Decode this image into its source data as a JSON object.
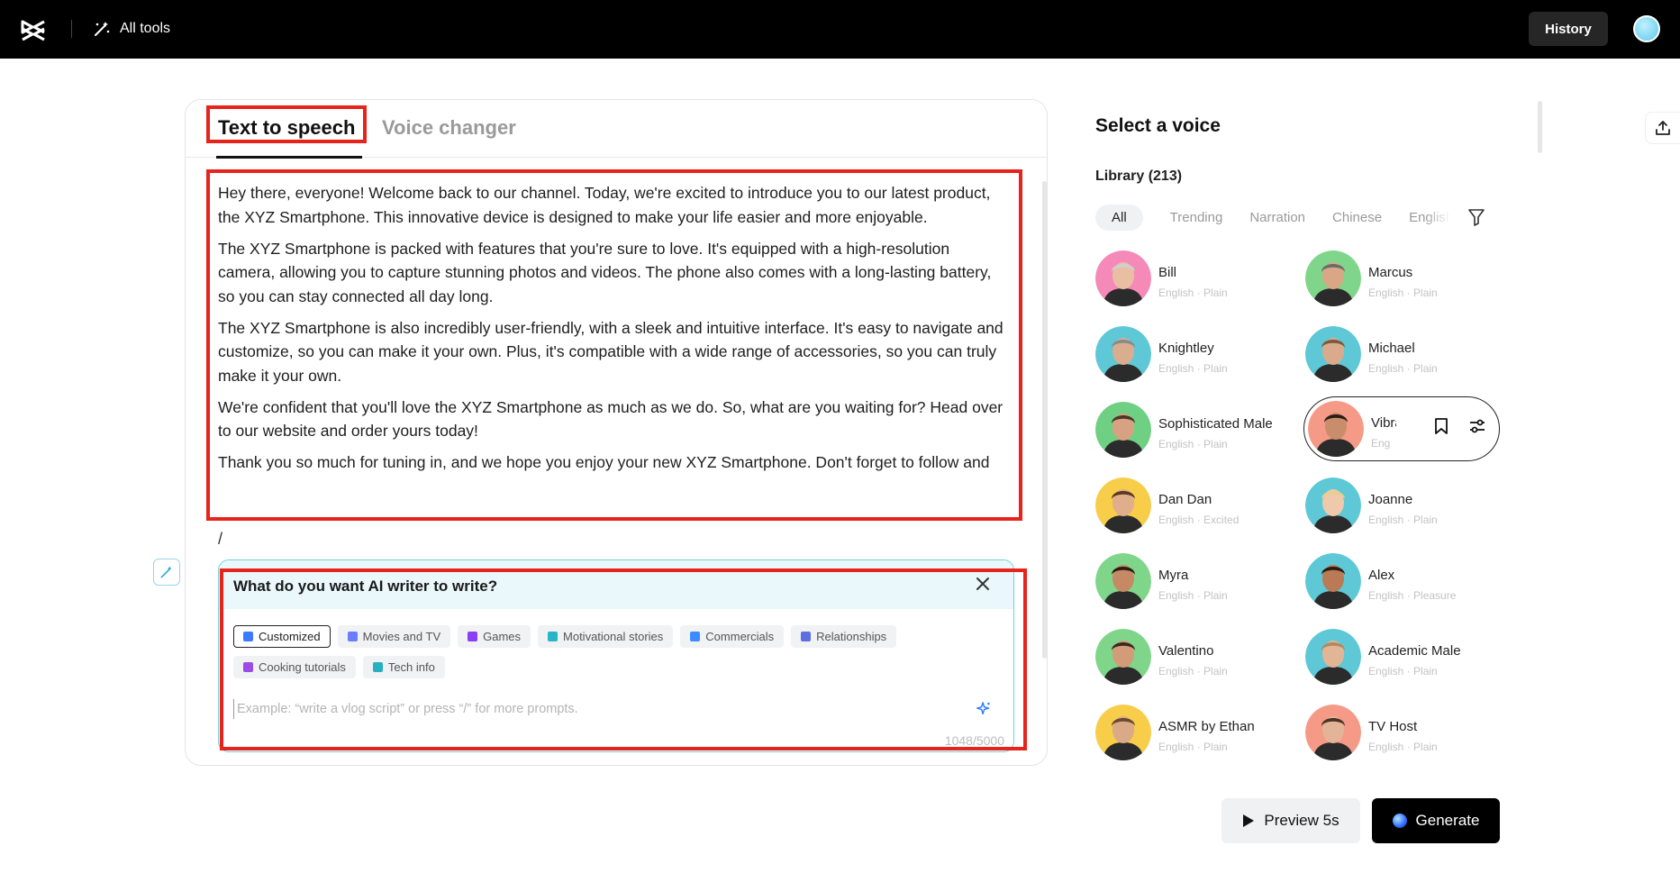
{
  "topbar": {
    "all_tools_label": "All tools",
    "history_label": "History"
  },
  "tabs": {
    "active": "Text to speech",
    "inactive": "Voice changer"
  },
  "script_paragraphs": [
    "Hey there, everyone! Welcome back to our channel. Today, we're excited to introduce you to our latest product, the XYZ Smartphone. This innovative device is designed to make your life easier and more enjoyable.",
    "The XYZ Smartphone is packed with features that you're sure to love. It's equipped with a high-resolution camera, allowing you to capture stunning photos and videos. The phone also comes with a long-lasting battery, so you can stay connected all day long.",
    "The XYZ Smartphone is also incredibly user-friendly, with a sleek and intuitive interface. It's easy to navigate and customize, so you can make it your own. Plus, it's compatible with a wide range of accessories, so you can truly make it your own.",
    "We're confident that you'll love the XYZ Smartphone as much as we do. So, what are you waiting for? Head over to our website and order yours today!",
    "Thank you so much for tuning in, and we hope you enjoy your new XYZ Smartphone. Don't forget to follow and subscribe for more exciting product announcements. Until next time, stay awesome!"
  ],
  "slash_text": "/",
  "ai_writer": {
    "title": "What do you want AI writer to write?",
    "chips": [
      {
        "label": "Customized",
        "color": "#3b7cff"
      },
      {
        "label": "Movies and TV",
        "color": "#6a7dff"
      },
      {
        "label": "Games",
        "color": "#8a3ff0"
      },
      {
        "label": "Motivational stories",
        "color": "#28b5c9"
      },
      {
        "label": "Commercials",
        "color": "#3c8cff"
      },
      {
        "label": "Relationships",
        "color": "#5c6fe0"
      },
      {
        "label": "Cooking tutorials",
        "color": "#9b4ce6"
      },
      {
        "label": "Tech info",
        "color": "#27b0c2"
      }
    ],
    "placeholder": "Example: “write a vlog script” or press “/” for more prompts.",
    "counter": "1048/5000"
  },
  "voice_panel": {
    "title": "Select a voice",
    "library": "Library (213)",
    "filters": [
      "All",
      "Trending",
      "Narration",
      "Chinese",
      "English"
    ],
    "voices": [
      {
        "name": "Bill",
        "desc": "English · Plain",
        "bg": "#f58ab8",
        "skin": "#e9bfa3",
        "hair": "#cfcfcf"
      },
      {
        "name": "Marcus",
        "desc": "English · Plain",
        "bg": "#7fd68a",
        "skin": "#d9a786",
        "hair": "#6b6b6b"
      },
      {
        "name": "Knightley",
        "desc": "English · Plain",
        "bg": "#5ec8d6",
        "skin": "#d8ad90",
        "hair": "#8a8a8a"
      },
      {
        "name": "Michael",
        "desc": "English · Plain",
        "bg": "#5ec8d6",
        "skin": "#d9ab8c",
        "hair": "#7a5a40"
      },
      {
        "name": "Sophisticated Male",
        "desc": "English · Plain",
        "bg": "#6fd083",
        "skin": "#d6a283",
        "hair": "#4a3526"
      },
      {
        "name": "Vibrant",
        "desc": "English · Plain",
        "bg": "#f59a86",
        "skin": "#c98d6c",
        "hair": "#2a1d16"
      },
      {
        "name": "Dan Dan",
        "desc": "English · Excited",
        "bg": "#f7cd4a",
        "skin": "#e0ae8a",
        "hair": "#5a3a22"
      },
      {
        "name": "Joanne",
        "desc": "English · Plain",
        "bg": "#5ec8d6",
        "skin": "#efc9ac",
        "hair": "#e7cf94"
      },
      {
        "name": "Myra",
        "desc": "English · Plain",
        "bg": "#7fd68a",
        "skin": "#c58a64",
        "hair": "#2b1b12"
      },
      {
        "name": "Alex",
        "desc": "English · Pleasure",
        "bg": "#5ec8d6",
        "skin": "#b97a55",
        "hair": "#2a1a10"
      },
      {
        "name": "Valentino",
        "desc": "English · Plain",
        "bg": "#7fd68a",
        "skin": "#d29c78",
        "hair": "#3a2a1e"
      },
      {
        "name": "Academic Male",
        "desc": "English · Plain",
        "bg": "#5ec8d6",
        "skin": "#e3b597",
        "hair": "#b08a60"
      },
      {
        "name": "ASMR by Ethan",
        "desc": "English · Plain",
        "bg": "#f7cd4a",
        "skin": "#d9a988",
        "hair": "#6a4a2e"
      },
      {
        "name": "TV Host",
        "desc": "English · Plain",
        "bg": "#f59a86",
        "skin": "#e3b497",
        "hair": "#4a3325"
      }
    ]
  },
  "buttons": {
    "preview": "Preview 5s",
    "generate": "Generate"
  }
}
